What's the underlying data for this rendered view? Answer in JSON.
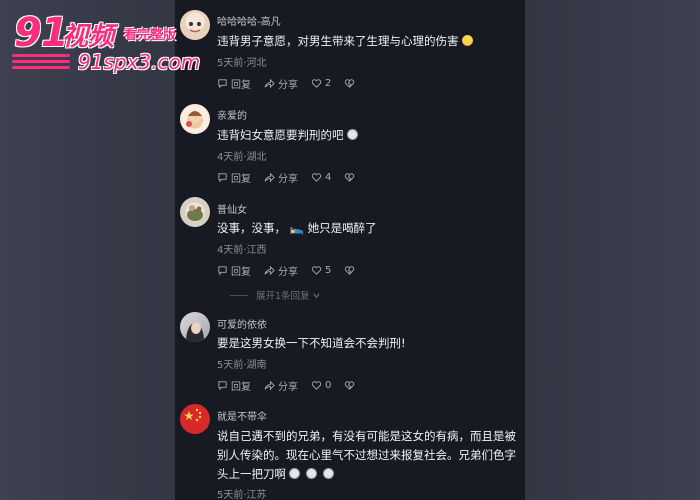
{
  "watermark": {
    "logo_number": "91",
    "logo_cn": "视频",
    "tagline": "看完整版",
    "url": "91spx3.com"
  },
  "comments": [
    {
      "user": "哈哈哈哈-高凡",
      "text": "违背男子意愿，对男生带来了生理与心理的伤害",
      "emoji": "cold-sweat-emoji",
      "meta": "5天前·河北",
      "reply": "回复",
      "share": "分享",
      "likes": "2"
    },
    {
      "user": "亲爱的",
      "text": "违背妇女意愿要判刑的吧",
      "emoji": "cat-emoji",
      "meta": "4天前·湖北",
      "reply": "回复",
      "share": "分享",
      "likes": "4"
    },
    {
      "user": "普仙女",
      "text": "没事，没事， 🛌 她只是喝醉了",
      "meta": "4天前·江西",
      "reply": "回复",
      "share": "分享",
      "likes": "5"
    },
    {
      "user": "可爱的依依",
      "text": "要是这男女换一下不知道会不会判刑!",
      "meta": "5天前·湖南",
      "reply": "回复",
      "share": "分享",
      "likes": "0"
    },
    {
      "user": "就是不带伞",
      "text": "说自己遇不到的兄弟，有没有可能是这女的有病，而且是被别人传染的。现在心里气不过想过来报复社会。兄弟们色字头上一把刀啊",
      "meta": "5天前·江苏"
    }
  ],
  "expand_replies": "展开1条回复",
  "colors": {
    "panel_bg": "#171a22",
    "watermark": "#ff2d7c"
  }
}
